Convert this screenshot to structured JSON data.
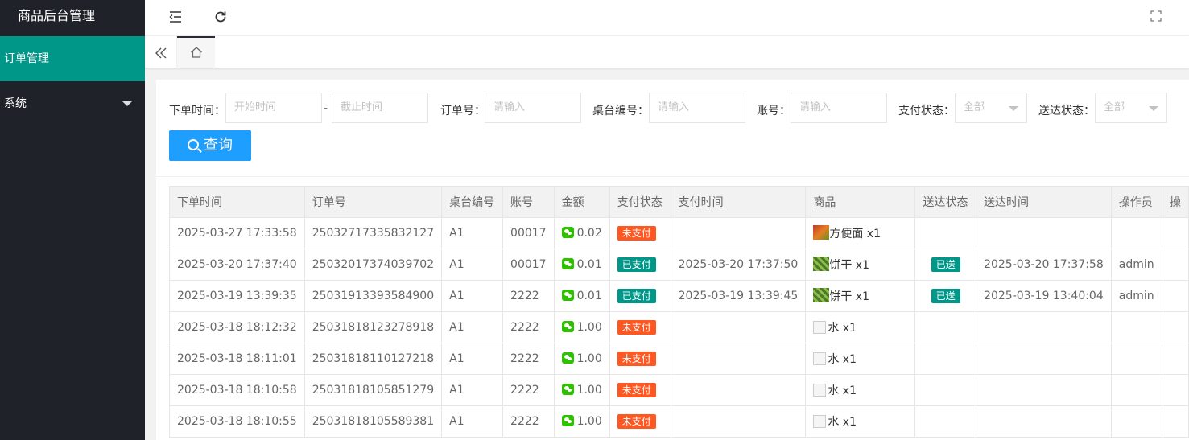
{
  "app": {
    "title": "商品后台管理"
  },
  "sidebar": {
    "items": [
      {
        "label": "订单管理",
        "active": true
      },
      {
        "label": "系统",
        "active": false
      }
    ]
  },
  "header": {
    "icons": [
      "collapse-menu-icon",
      "refresh-icon",
      "fullscreen-icon"
    ]
  },
  "tabs": {
    "prev_icon": "double-chevron-left-icon",
    "home_icon": "home-icon"
  },
  "search": {
    "order_time_label": "下单时间：",
    "start_placeholder": "开始时间",
    "range_sep": "-",
    "end_placeholder": "截止时间",
    "order_no_label": "订单号：",
    "order_no_placeholder": "请输入",
    "table_no_label": "桌台编号：",
    "table_no_placeholder": "请输入",
    "account_label": "账号：",
    "account_placeholder": "请输入",
    "pay_status_label": "支付状态：",
    "pay_status_value": "全部",
    "delivery_status_label": "送达状态：",
    "delivery_status_value": "全部",
    "query_button": "查询"
  },
  "table": {
    "columns": [
      "下单时间",
      "订单号",
      "桌台编号",
      "账号",
      "金额",
      "支付状态",
      "支付时间",
      "商品",
      "送达状态",
      "送达时间",
      "操作员",
      "操"
    ],
    "rows": [
      {
        "order_time": "2025-03-27 17:33:58",
        "order_no": "25032717335832127",
        "table_no": "A1",
        "account": "00017",
        "amount": "0.02",
        "pay_status": "未支付",
        "pay_time": "",
        "goods": "方便面 x1",
        "goods_thumb": "noodle",
        "delivery": "",
        "delivery_time": "",
        "operator": ""
      },
      {
        "order_time": "2025-03-20 17:37:40",
        "order_no": "25032017374039702",
        "table_no": "A1",
        "account": "00017",
        "amount": "0.01",
        "pay_status": "已支付",
        "pay_time": "2025-03-20 17:37:50",
        "goods": "饼干 x1",
        "goods_thumb": "biscuit",
        "delivery": "已送",
        "delivery_time": "2025-03-20 17:37:58",
        "operator": "admin"
      },
      {
        "order_time": "2025-03-19 13:39:35",
        "order_no": "25031913393584900",
        "table_no": "A1",
        "account": "2222",
        "amount": "0.01",
        "pay_status": "已支付",
        "pay_time": "2025-03-19 13:39:45",
        "goods": "饼干 x1",
        "goods_thumb": "biscuit",
        "delivery": "已送",
        "delivery_time": "2025-03-19 13:40:04",
        "operator": "admin"
      },
      {
        "order_time": "2025-03-18 18:12:32",
        "order_no": "25031818123278918",
        "table_no": "A1",
        "account": "2222",
        "amount": "1.00",
        "pay_status": "未支付",
        "pay_time": "",
        "goods": "水 x1",
        "goods_thumb": "water",
        "delivery": "",
        "delivery_time": "",
        "operator": ""
      },
      {
        "order_time": "2025-03-18 18:11:01",
        "order_no": "25031818110127218",
        "table_no": "A1",
        "account": "2222",
        "amount": "1.00",
        "pay_status": "未支付",
        "pay_time": "",
        "goods": "水 x1",
        "goods_thumb": "water",
        "delivery": "",
        "delivery_time": "",
        "operator": ""
      },
      {
        "order_time": "2025-03-18 18:10:58",
        "order_no": "25031818105851279",
        "table_no": "A1",
        "account": "2222",
        "amount": "1.00",
        "pay_status": "未支付",
        "pay_time": "",
        "goods": "水 x1",
        "goods_thumb": "water",
        "delivery": "",
        "delivery_time": "",
        "operator": ""
      },
      {
        "order_time": "2025-03-18 18:10:55",
        "order_no": "25031818105589381",
        "table_no": "A1",
        "account": "2222",
        "amount": "1.00",
        "pay_status": "未支付",
        "pay_time": "",
        "goods": "水 x1",
        "goods_thumb": "water",
        "delivery": "",
        "delivery_time": "",
        "operator": ""
      }
    ]
  },
  "colors": {
    "sidebar_bg": "#20222a",
    "active_green": "#009688",
    "query_blue": "#1e9fff",
    "unpaid_orange": "#ff5722",
    "wechat_green": "#2dc100"
  }
}
